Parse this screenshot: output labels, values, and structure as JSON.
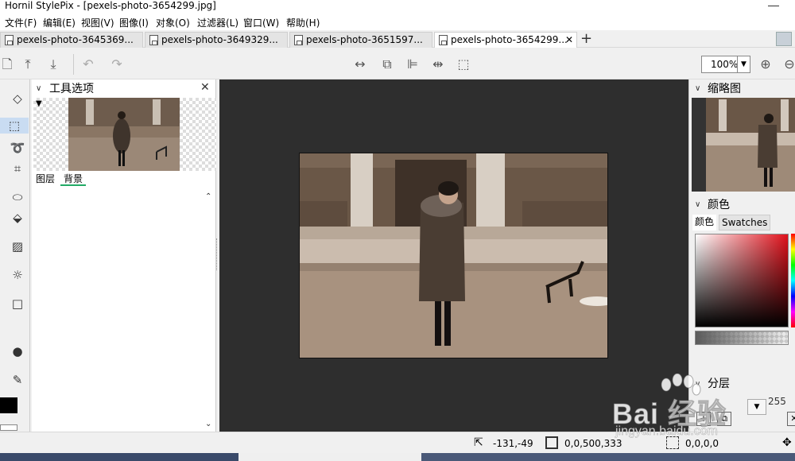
{
  "window": {
    "title": "Hornil StylePix - [pexels-photo-3654299.jpg]"
  },
  "menu": [
    "文件(F)",
    "编辑(E)",
    "视图(V)",
    "图像(I)",
    "对象(O)",
    "过滤器(L)",
    "窗口(W)",
    "帮助(H)"
  ],
  "tabs": [
    {
      "label": "pexels-photo-3645369...",
      "active": false
    },
    {
      "label": "pexels-photo-3649329...",
      "active": false
    },
    {
      "label": "pexels-photo-3651597...",
      "active": false
    },
    {
      "label": "pexels-photo-3654299...",
      "active": true
    }
  ],
  "tab_close_glyph": "✕",
  "new_tab_glyph": "+",
  "toolbar": {
    "zoom": "100%"
  },
  "tool_options": {
    "title": "工具选项",
    "sub_tabs": [
      "图层",
      "背景"
    ],
    "selected_sub_tab": "背景"
  },
  "thumbnail_panel": {
    "title": "缩略图"
  },
  "color_panel": {
    "title": "颜色",
    "tabs": [
      "颜色",
      "Swatches"
    ],
    "active_tab": "颜色"
  },
  "layers_panel": {
    "title": "分层",
    "opacity": "255"
  },
  "status": {
    "cursor": "-131,-49",
    "image_rect": "0,0,500,333",
    "selection": "0,0,0,0"
  },
  "watermark": {
    "logo": "Bai 经验",
    "url": "jingyan.baidu.com"
  },
  "colors": {
    "canvas_bg": "#2e2e2e",
    "photo_tone": "#8a7664",
    "selected_tool": "#c9dcf2",
    "foreground": "#000000",
    "background": "#ffffff"
  }
}
